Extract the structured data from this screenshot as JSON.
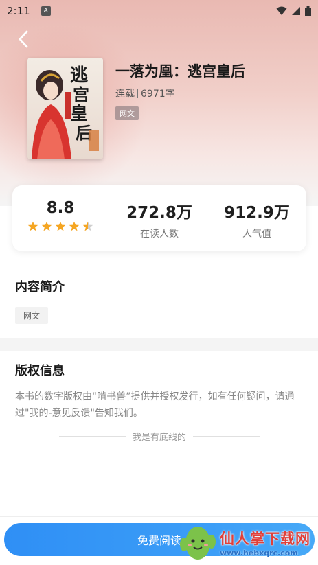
{
  "status_bar": {
    "time": "2:11",
    "app_icon_letter": "A",
    "icons": [
      "wifi-icon",
      "signal-icon",
      "battery-icon"
    ]
  },
  "header": {
    "back_icon": "chevron-left-icon"
  },
  "book": {
    "title": "一落为凰：逃宫皇后",
    "status": "连载",
    "word_count": "6971字",
    "genre_tag": "网文",
    "cover_title_text": "逃宫皇后"
  },
  "stats": {
    "rating": "8.8",
    "rating_stars": 4.5,
    "readers_value": "272.8万",
    "readers_label": "在读人数",
    "popularity_value": "912.9万",
    "popularity_label": "人气值"
  },
  "intro": {
    "title": "内容简介",
    "tag": "网文"
  },
  "copyright": {
    "title": "版权信息",
    "text": "本书的数字版权由“啃书兽”提供并授权发行，如有任何疑问，请通过\"我的-意见反馈\"告知我们。",
    "end_text": "我是有底线的"
  },
  "bottom": {
    "read_button_label": "免费阅读"
  },
  "watermark": {
    "name": "仙人掌下载网",
    "url": "www.hebxqrc.com"
  },
  "colors": {
    "accent": "#3a9cf7",
    "star": "#f5a623"
  }
}
